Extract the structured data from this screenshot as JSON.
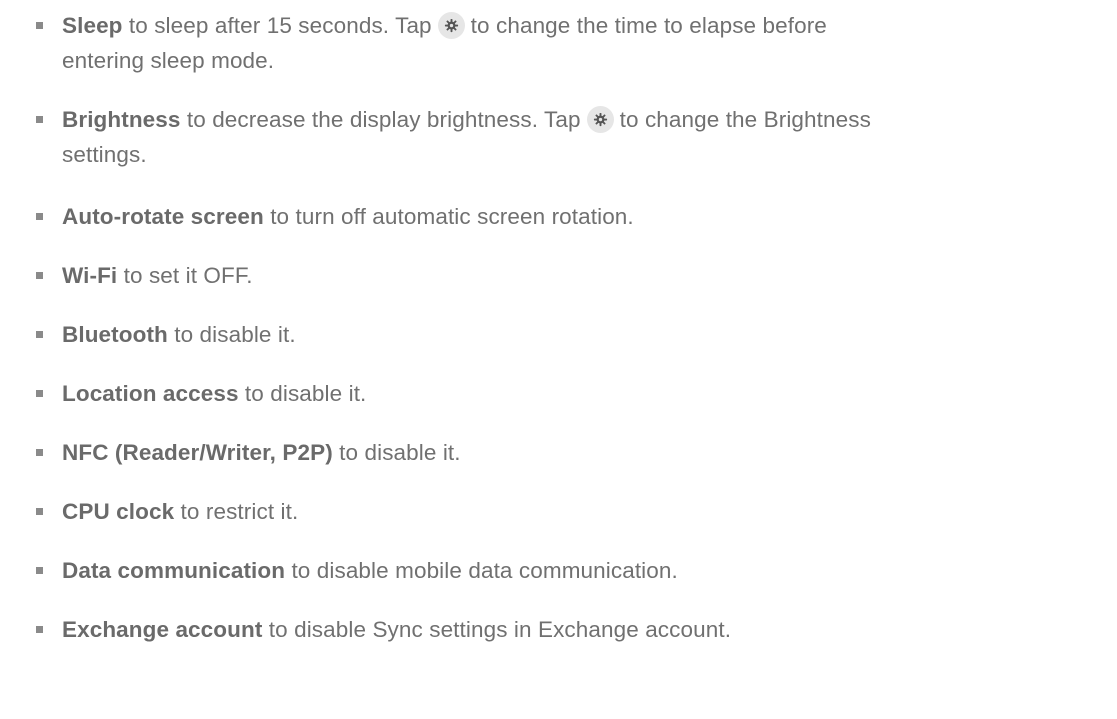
{
  "items": [
    {
      "term": "Sleep",
      "before_icon": " to sleep after 15 seconds. Tap",
      "icon": "gear-icon",
      "after_icon": "to change the time to elapse before",
      "line2": "entering sleep mode."
    },
    {
      "term": "Brightness",
      "before_icon": " to decrease the display brightness. Tap",
      "icon": "gear-icon",
      "after_icon": "to change the Brightness",
      "line2": "settings."
    },
    {
      "term": "Auto-rotate screen",
      "desc": " to turn off automatic screen rotation."
    },
    {
      "term": "Wi-Fi",
      "desc": " to set it OFF."
    },
    {
      "term": "Bluetooth",
      "desc": " to disable it."
    },
    {
      "term": "Location access",
      "desc": " to disable it."
    },
    {
      "term": "NFC (Reader/Writer, P2P)",
      "desc": " to disable it."
    },
    {
      "term": "CPU clock",
      "desc": " to restrict it."
    },
    {
      "term": "Data communication",
      "desc": " to disable mobile data communication."
    },
    {
      "term": "Exchange account",
      "desc": " to disable Sync settings in Exchange account."
    }
  ],
  "colors": {
    "text": "#707070",
    "term": "#6a6a6a",
    "bullet": "#8a8a8a",
    "icon_bg": "#e6e6e6",
    "icon_fg": "#555555"
  }
}
